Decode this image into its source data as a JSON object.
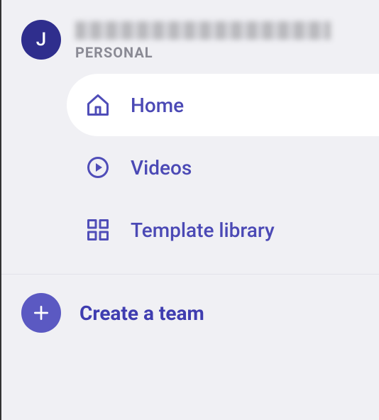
{
  "workspace": {
    "avatar_initial": "J",
    "type_label": "PERSONAL"
  },
  "nav": {
    "items": [
      {
        "key": "home",
        "label": "Home",
        "active": true
      },
      {
        "key": "videos",
        "label": "Videos",
        "active": false
      },
      {
        "key": "templates",
        "label": "Template library",
        "active": false
      }
    ]
  },
  "create_team": {
    "label": "Create a team"
  }
}
